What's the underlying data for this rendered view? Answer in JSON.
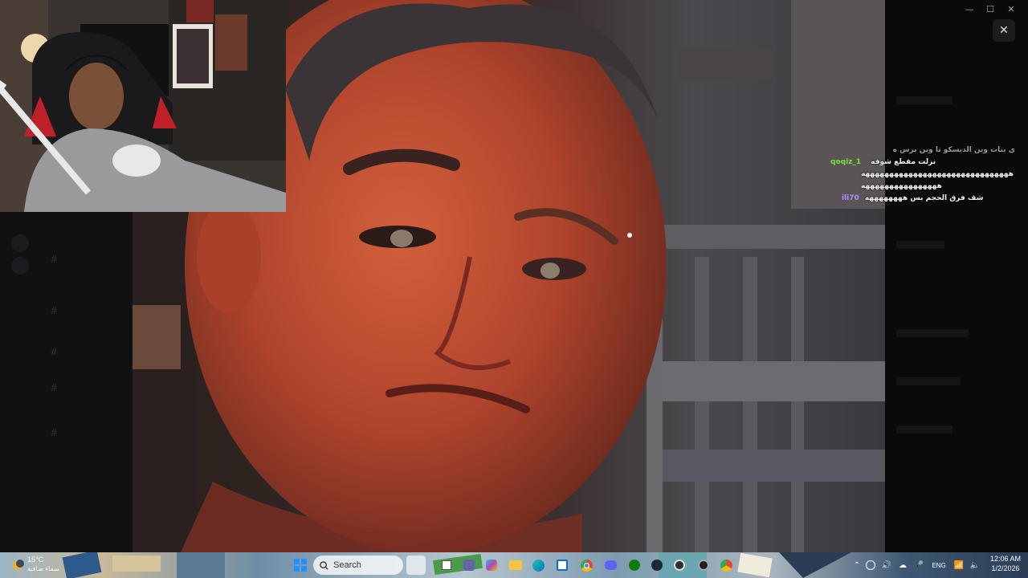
{
  "window": {
    "minimize_glyph": "—",
    "maximize_glyph": "☐",
    "close_glyph": "✕"
  },
  "viewer": {
    "close_glyph": "✕"
  },
  "chat": {
    "lines": [
      {
        "user": "",
        "message": "ي بنات وين الديسكو تا وين برس ه",
        "user_color": "#9a9a9a"
      },
      {
        "user": "qoqiz_1",
        "message": "نزلت مقطع شوفه",
        "user_color": "#7ae23a"
      },
      {
        "user": "",
        "message": "هههههههههههههههههههههههههههههههه",
        "user_color": "#e0334a"
      },
      {
        "user": "",
        "message": "ههههههههههههههههه",
        "user_color": "#e0334a"
      },
      {
        "user": "ili70",
        "message": "شف فرق الحجم بس ههههههههه",
        "user_color": "#b38cff"
      }
    ]
  },
  "taskbar": {
    "weather_temp": "15°C",
    "weather_condition": "سماء صافية",
    "search_placeholder": "Search",
    "language": "ENG",
    "time": "12:06 AM",
    "date": "1/2/2026"
  }
}
